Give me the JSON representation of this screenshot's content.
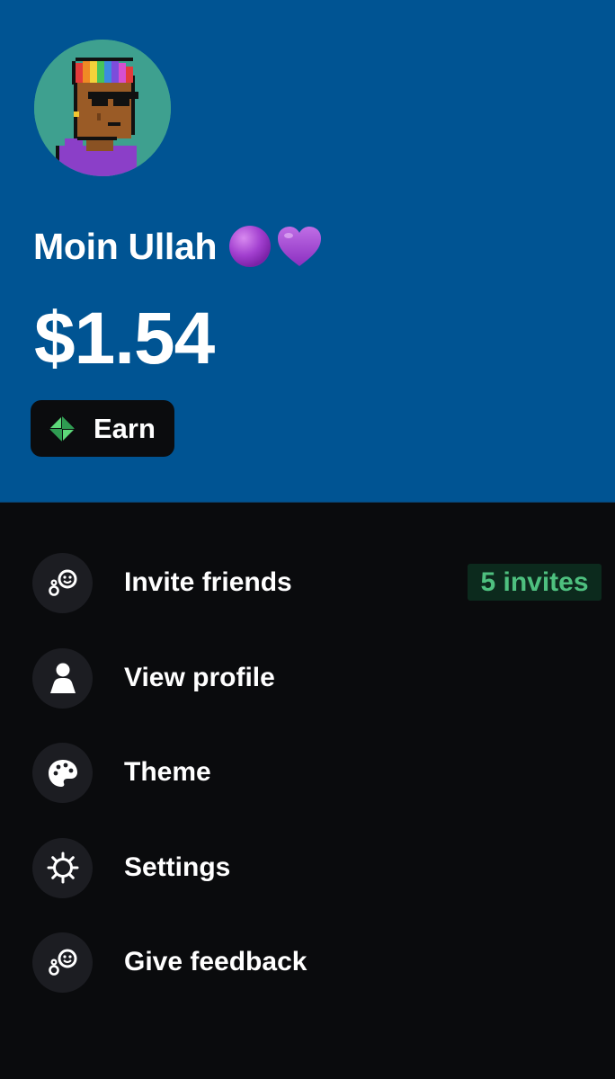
{
  "profile": {
    "name": "Moin Ullah",
    "name_emojis": [
      "purple-circle",
      "purple-heart"
    ],
    "balance": "$1.54"
  },
  "earn_button": {
    "label": "Earn",
    "icon": "sparkle-diamond-icon",
    "icon_color": "#5ed97a"
  },
  "menu": {
    "items": [
      {
        "label": "Invite friends",
        "icon": "invite-friends-icon",
        "badge": "5 invites"
      },
      {
        "label": "View profile",
        "icon": "person-icon"
      },
      {
        "label": "Theme",
        "icon": "palette-icon"
      },
      {
        "label": "Settings",
        "icon": "gear-icon"
      },
      {
        "label": "Give feedback",
        "icon": "feedback-icon"
      }
    ]
  },
  "colors": {
    "header_bg": "#005493",
    "page_bg": "#0a0b0d",
    "icon_circle_bg": "#1c1d22",
    "badge_text": "#4ec07f",
    "badge_bg": "#0c2a1d",
    "avatar_bg": "#3ea08f"
  }
}
